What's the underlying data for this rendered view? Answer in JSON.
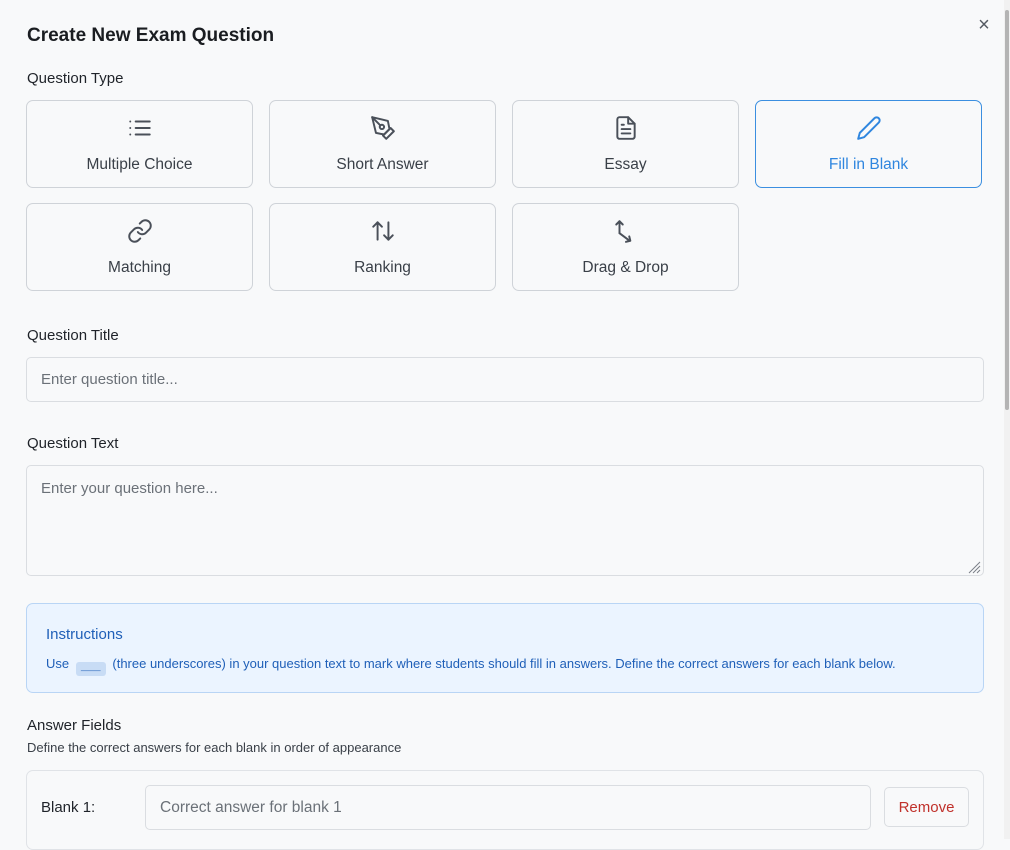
{
  "dialog": {
    "title": "Create New Exam Question",
    "close_glyph": "×"
  },
  "question_type": {
    "label": "Question Type",
    "selected": "Fill in Blank",
    "types": [
      {
        "label": "Multiple Choice",
        "icon": "list-icon"
      },
      {
        "label": "Short Answer",
        "icon": "pen-tool-icon"
      },
      {
        "label": "Essay",
        "icon": "file-text-icon"
      },
      {
        "label": "Fill in Blank",
        "icon": "pencil-icon"
      },
      {
        "label": "Matching",
        "icon": "link-icon"
      },
      {
        "label": "Ranking",
        "icon": "arrows-up-down-icon"
      },
      {
        "label": "Drag & Drop",
        "icon": "move-arrow-icon"
      }
    ]
  },
  "question_title": {
    "label": "Question Title",
    "placeholder": "Enter question title..."
  },
  "question_text": {
    "label": "Question Text",
    "placeholder": "Enter your question here..."
  },
  "instructions": {
    "title": "Instructions",
    "text_before": "Use",
    "code": "___",
    "text_after": "(three underscores) in your question text to mark where students should fill in answers. Define the correct answers for each blank below."
  },
  "answer_fields": {
    "title": "Answer Fields",
    "subtitle": "Define the correct answers for each blank in order of appearance",
    "blanks": [
      {
        "label": "Blank 1:",
        "placeholder": "Correct answer for blank 1",
        "remove_label": "Remove"
      }
    ]
  },
  "colors": {
    "accent": "#2f86df",
    "danger": "#c0312b",
    "info_bg": "#ebf4ff",
    "info_text": "#1f5fb8"
  }
}
